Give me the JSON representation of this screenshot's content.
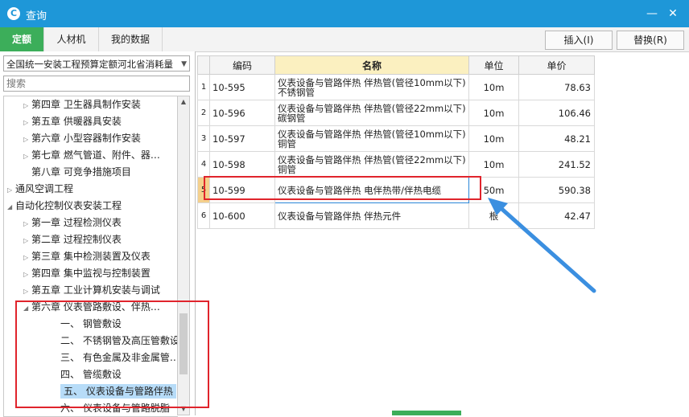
{
  "window": {
    "title": "查询",
    "app_icon": "app-logo-icon",
    "min_icon": "minimize-icon",
    "close_icon": "close-icon"
  },
  "tabs": [
    "定额",
    "人材机",
    "我的数据"
  ],
  "buttons": {
    "insert": "插入(I)",
    "replace": "替换(R)"
  },
  "left": {
    "library": "全国统一安装工程预算定额河北省消耗量",
    "search_placeholder": "搜索",
    "tree": [
      {
        "label": "第四章  卫生器具制作安装",
        "level": 2,
        "toggle": "collapsed"
      },
      {
        "label": "第五章  供暖器具安装",
        "level": 2,
        "toggle": "collapsed"
      },
      {
        "label": "第六章  小型容器制作安装",
        "level": 2,
        "toggle": "collapsed"
      },
      {
        "label": "第七章  燃气管道、附件、器…",
        "level": 2,
        "toggle": "collapsed"
      },
      {
        "label": "第八章  可竞争措施项目",
        "level": 2,
        "toggle": "none"
      },
      {
        "label": "通风空调工程",
        "level": 1,
        "toggle": "collapsed"
      },
      {
        "label": "自动化控制仪表安装工程",
        "level": 1,
        "toggle": "expanded"
      },
      {
        "label": "第一章  过程检测仪表",
        "level": 2,
        "toggle": "collapsed"
      },
      {
        "label": "第二章  过程控制仪表",
        "level": 2,
        "toggle": "collapsed"
      },
      {
        "label": "第三章  集中检测装置及仪表",
        "level": 2,
        "toggle": "collapsed"
      },
      {
        "label": "第四章  集中监视与控制装置",
        "level": 2,
        "toggle": "collapsed"
      },
      {
        "label": "第五章  工业计算机安装与调试",
        "level": 2,
        "toggle": "collapsed"
      },
      {
        "label": "第六章  仪表管路敷设、伴热…",
        "level": 2,
        "toggle": "expanded"
      },
      {
        "label": "一、  钢管敷设",
        "level": 3,
        "toggle": "none"
      },
      {
        "label": "二、  不锈钢管及高压管敷设",
        "level": 3,
        "toggle": "none"
      },
      {
        "label": "三、  有色金属及非金属管…",
        "level": 3,
        "toggle": "none"
      },
      {
        "label": "四、  管缆敷设",
        "level": 3,
        "toggle": "none"
      },
      {
        "label": "五、  仪表设备与管路伴热",
        "level": 3,
        "toggle": "none",
        "selected": true
      },
      {
        "label": "六、  仪表设备与管路脱脂",
        "level": 3,
        "toggle": "none"
      }
    ]
  },
  "table": {
    "headers": [
      "",
      "编码",
      "名称",
      "单位",
      "单价"
    ],
    "rows": [
      {
        "idx": "1",
        "code": "10-595",
        "name": "仪表设备与管路伴热 伴热管(管径10mm以下)不锈钢管",
        "unit": "10m",
        "price": "78.63"
      },
      {
        "idx": "2",
        "code": "10-596",
        "name": "仪表设备与管路伴热 伴热管(管径22mm以下)碳钢管",
        "unit": "10m",
        "price": "106.46"
      },
      {
        "idx": "3",
        "code": "10-597",
        "name": "仪表设备与管路伴热 伴热管(管径10mm以下)铜管",
        "unit": "10m",
        "price": "48.21"
      },
      {
        "idx": "4",
        "code": "10-598",
        "name": "仪表设备与管路伴热 伴热管(管径22mm以下)铜管",
        "unit": "10m",
        "price": "241.52"
      },
      {
        "idx": "5",
        "code": "10-599",
        "name": "仪表设备与管路伴热 电伴热带/伴热电缆",
        "unit": "50m",
        "price": "590.38"
      },
      {
        "idx": "6",
        "code": "10-600",
        "name": "仪表设备与管路伴热 伴热元件",
        "unit": "根",
        "price": "42.47"
      }
    ]
  },
  "colors": {
    "title_bar": "#1e97d8",
    "active_tab": "#3cae5a",
    "highlight": "#e0242c",
    "arrow": "#3b8fe0",
    "selection": "#b7dcf8"
  }
}
